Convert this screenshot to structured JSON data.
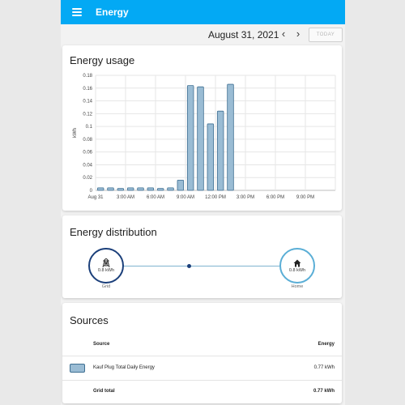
{
  "app": {
    "title": "Energy"
  },
  "datebar": {
    "date": "August 31, 2021",
    "prev_icon": "‹",
    "next_icon": "›",
    "today_label": "TODAY"
  },
  "usage": {
    "title": "Energy usage",
    "chart_data": {
      "type": "bar",
      "title": "Energy usage",
      "ylabel": "kWh",
      "xlabel": "",
      "ylim": [
        0,
        0.18
      ],
      "yticks": [
        "0",
        "0.02",
        "0.04",
        "0.06",
        "0.08",
        "0.1",
        "0.12",
        "0.14",
        "0.16",
        "0.18"
      ],
      "xlim_hours": [
        0,
        24
      ],
      "xticks": [
        {
          "hour": 0,
          "label": "Aug 31"
        },
        {
          "hour": 3,
          "label": "3:00 AM"
        },
        {
          "hour": 6,
          "label": "6:00 AM"
        },
        {
          "hour": 9,
          "label": "9:00 AM"
        },
        {
          "hour": 12,
          "label": "12:00 PM"
        },
        {
          "hour": 15,
          "label": "3:00 PM"
        },
        {
          "hour": 18,
          "label": "6:00 PM"
        },
        {
          "hour": 21,
          "label": "9:00 PM"
        }
      ],
      "hours": [
        0,
        1,
        2,
        3,
        4,
        5,
        6,
        7,
        8,
        9,
        10,
        11,
        12,
        13
      ],
      "values": [
        0.004,
        0.004,
        0.003,
        0.004,
        0.004,
        0.004,
        0.003,
        0.004,
        0.016,
        0.164,
        0.162,
        0.104,
        0.124,
        0.166
      ],
      "grid": true,
      "bar_color": "#9abcd4",
      "bar_border": "#3e6f92"
    }
  },
  "distribution": {
    "title": "Energy distribution",
    "grid": {
      "value": "0.8 kWh",
      "label": "Grid",
      "icon": "transmission-tower-icon"
    },
    "home": {
      "value": "0.8 kWh",
      "label": "Home",
      "icon": "home-icon"
    },
    "colors": {
      "grid": "#1b3f7a",
      "home": "#5aaed6",
      "line": "#7fb3cf"
    }
  },
  "sources": {
    "title": "Sources",
    "headers": {
      "source": "Source",
      "energy": "Energy"
    },
    "rows": [
      {
        "name": "Kauf Plug Total Daily Energy",
        "energy": "0.77 kWh"
      }
    ],
    "total": {
      "label": "Grid total",
      "energy": "0.77 kWh"
    }
  }
}
